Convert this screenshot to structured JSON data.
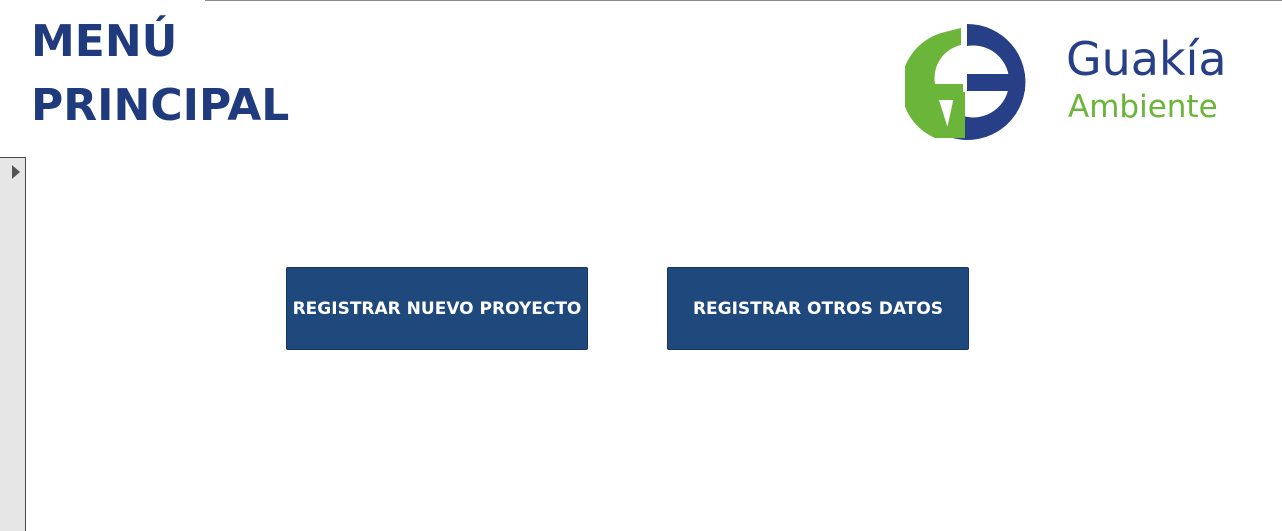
{
  "header": {
    "title_line1": "MENÚ",
    "title_line2": "PRINCIPAL"
  },
  "brand": {
    "name": "Guakía",
    "subtitle": "Ambiente",
    "logo_icon": "ag-logo-icon",
    "primary_color": "#263f86",
    "secondary_color": "#6bb53a"
  },
  "actions": {
    "register_new_project": "REGISTRAR NUEVO PROYECTO",
    "register_other_data": "REGISTRAR OTROS DATOS",
    "button_color": "#1f497d"
  },
  "side_panel": {
    "expand_icon": "triangle-right-icon"
  }
}
